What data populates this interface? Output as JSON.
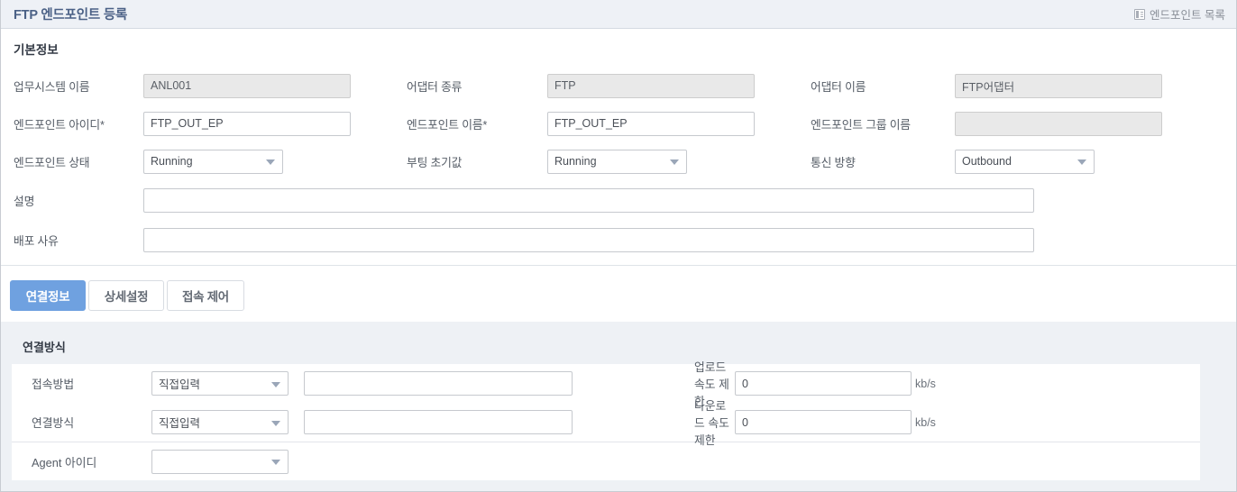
{
  "header": {
    "title": "FTP 엔드포인트 등록",
    "list_link": "엔드포인트 목록",
    "list_icon": "list-icon"
  },
  "basic": {
    "section_title": "기본정보",
    "fields": {
      "system_name_label": "업무시스템 이름",
      "system_name_value": "ANL001",
      "adapter_type_label": "어댑터 종류",
      "adapter_type_value": "FTP",
      "adapter_name_label": "어댑터 이름",
      "adapter_name_value": "FTP어댑터",
      "endpoint_id_label": "엔드포인트 아이디*",
      "endpoint_id_value": "FTP_OUT_EP",
      "endpoint_name_label": "엔드포인트 이름*",
      "endpoint_name_value": "FTP_OUT_EP",
      "endpoint_group_label": "엔드포인트 그룹 이름",
      "endpoint_group_value": "",
      "endpoint_state_label": "엔드포인트 상태",
      "endpoint_state_value": "Running",
      "boot_default_label": "부팅 초기값",
      "boot_default_value": "Running",
      "direction_label": "통신 방향",
      "direction_value": "Outbound",
      "description_label": "설명",
      "description_value": "",
      "deploy_reason_label": "배포 사유",
      "deploy_reason_value": ""
    }
  },
  "tabs": [
    {
      "label": "연결정보",
      "active": true
    },
    {
      "label": "상세설정",
      "active": false
    },
    {
      "label": "접속 제어",
      "active": false
    }
  ],
  "connection": {
    "panel_title": "연결방식",
    "access_method_label": "접속방법",
    "access_method_value": "직접입력",
    "access_method_text": "",
    "connect_method_label": "연결방식",
    "connect_method_value": "직접입력",
    "connect_method_text": "",
    "agent_id_label": "Agent 아이디",
    "agent_id_value": "",
    "upload_limit_label": "업로드 속도 제한",
    "upload_limit_value": "0",
    "upload_unit": "kb/s",
    "download_limit_label": "다운로드 속도 제한",
    "download_limit_value": "0",
    "download_unit": "kb/s"
  },
  "colors": {
    "accent": "#6fa1e0",
    "title_text": "#4b6186",
    "header_bg": "#eef1f6",
    "panel_bg": "#eef1f5",
    "disabled_bg": "#e9e9e9"
  }
}
